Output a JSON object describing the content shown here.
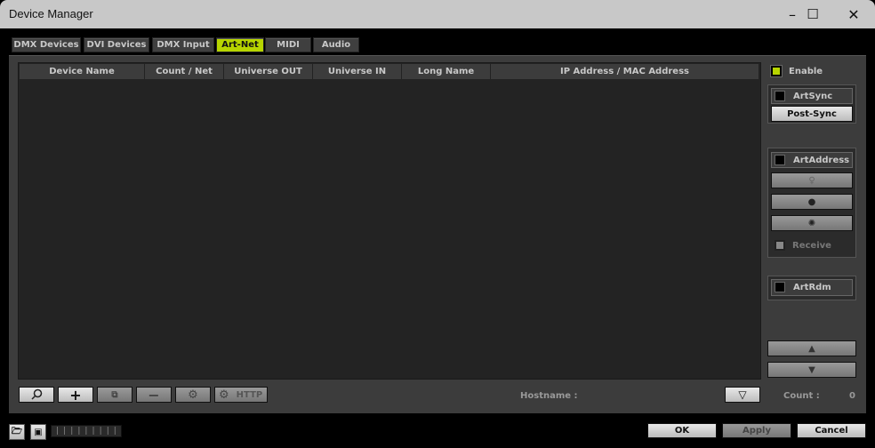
{
  "window": {
    "title": "Device Manager",
    "minimize": "–",
    "maximize": "☐",
    "close": "✕"
  },
  "tabs": [
    {
      "label": "DMX Devices"
    },
    {
      "label": "DVI Devices"
    },
    {
      "label": "DMX Input"
    },
    {
      "label": "Art-Net",
      "active": true
    },
    {
      "label": "MIDI"
    },
    {
      "label": "Audio"
    }
  ],
  "table": {
    "columns": [
      "Device Name",
      "Count / Net",
      "Universe OUT",
      "Universe IN",
      "Long Name",
      "IP Address / MAC Address"
    ],
    "rows": []
  },
  "sidebar": {
    "enable_label": "Enable",
    "enable_checked": true,
    "accent_color": "#b7d500",
    "artsync_label": "ArtSync",
    "postsync_label": "Post-Sync",
    "artaddress_label": "ArtAddress",
    "led_buttons": [
      "bulb-off-icon",
      "bulb-on-icon",
      "bulb-flash-icon"
    ],
    "receive_label": "Receive",
    "artrdm_label": "ArtRdm",
    "up_arrow": "▲",
    "down_arrow": "▼"
  },
  "toolbar": {
    "http_label": "HTTP",
    "hostname_label": "Hostname :",
    "count_label": "Count :",
    "count_value": "0"
  },
  "footer": {
    "ok_label": "OK",
    "apply_label": "Apply",
    "cancel_label": "Cancel"
  }
}
